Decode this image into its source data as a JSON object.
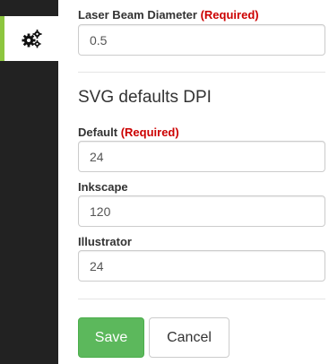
{
  "sidebar": {
    "active_tab_icon": "gears-icon",
    "accent_color": "#8dc63f"
  },
  "laser": {
    "label": "Laser Beam Diameter",
    "required": "(Required)",
    "value": "0.5"
  },
  "svg_dpi": {
    "title": "SVG defaults DPI",
    "default": {
      "label": "Default",
      "required": "(Required)",
      "value": "24"
    },
    "inkscape": {
      "label": "Inkscape",
      "value": "120"
    },
    "illustrator": {
      "label": "Illustrator",
      "value": "24"
    }
  },
  "actions": {
    "save_label": "Save",
    "cancel_label": "Cancel",
    "save_color": "#5cb85c"
  }
}
